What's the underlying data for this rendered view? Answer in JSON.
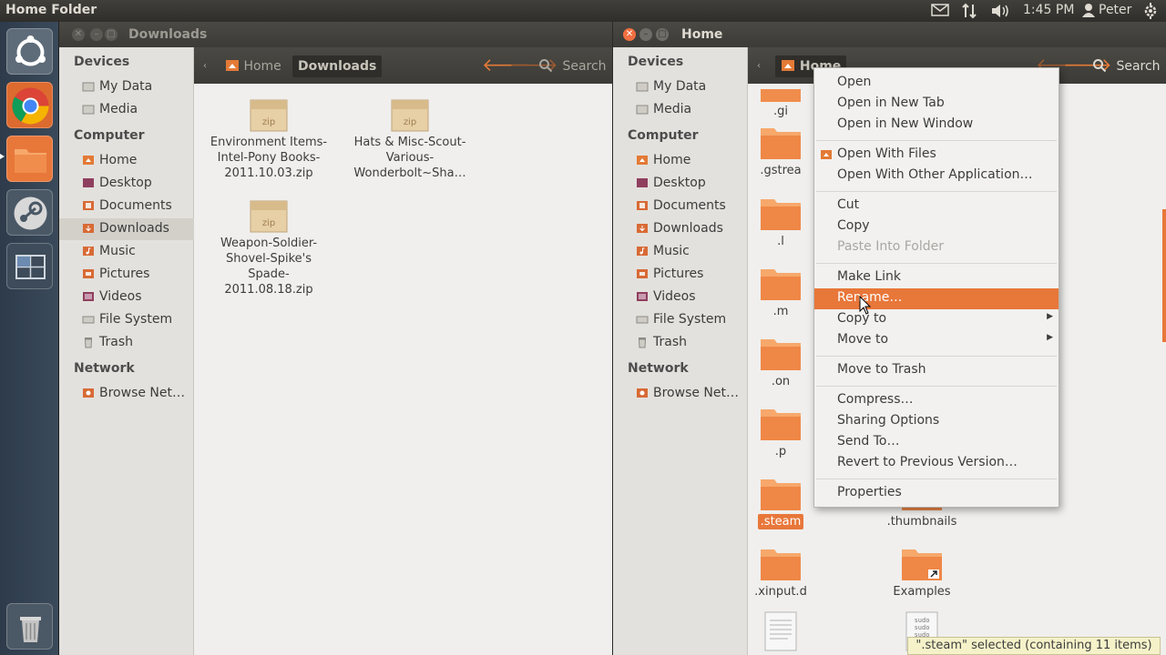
{
  "topbar": {
    "title": "Home Folder",
    "time": "1:45 PM",
    "user": "Peter",
    "icons": [
      "mail-icon",
      "network-icon",
      "volume-icon",
      "user-icon",
      "gear-icon"
    ]
  },
  "launcher": {
    "items": [
      "ubuntu-dash-icon",
      "chrome-icon",
      "files-icon",
      "steam-icon",
      "workspace-switcher-icon",
      "trash-icon"
    ]
  },
  "win_downloads": {
    "title": "Downloads",
    "sidebar": {
      "devices_head": "Devices",
      "devices": [
        "My Data",
        "Media"
      ],
      "computer_head": "Computer",
      "computer": [
        "Home",
        "Desktop",
        "Documents",
        "Downloads",
        "Music",
        "Pictures",
        "Videos",
        "File System",
        "Trash"
      ],
      "network_head": "Network",
      "network": [
        "Browse Net…"
      ]
    },
    "crumbs": [
      "Home",
      "Downloads"
    ],
    "search_label": "Search",
    "files": [
      {
        "icon": "zip",
        "name": "Environment Items-Intel-Pony Books-2011.10.03.zip"
      },
      {
        "icon": "zip",
        "name": "Hats & Misc-Scout-Various-Wonderbolt~Sha…"
      },
      {
        "icon": "zip",
        "name": "Weapon-Soldier-Shovel-Spike's Spade-2011.08.18.zip"
      }
    ]
  },
  "win_home": {
    "title": "Home",
    "sidebar": {
      "devices_head": "Devices",
      "devices": [
        "My Data",
        "Media"
      ],
      "computer_head": "Computer",
      "computer": [
        "Home",
        "Desktop",
        "Documents",
        "Downloads",
        "Music",
        "Pictures",
        "Videos",
        "File System",
        "Trash"
      ],
      "network_head": "Network",
      "network": [
        "Browse Net…"
      ]
    },
    "crumb": "Home",
    "search_label": "Search",
    "files_visible": [
      ".gi",
      ".gstrea",
      ".l",
      ".m",
      ".on",
      ".p",
      ".steam",
      ".thumbnails",
      ".xinput.d",
      "Examples"
    ]
  },
  "context_menu": {
    "groups": [
      [
        "Open",
        "Open in New Tab",
        "Open in New Window"
      ],
      [
        "Open With Files",
        "Open With Other Application…"
      ],
      [
        "Cut",
        "Copy",
        "Paste Into Folder"
      ],
      [
        "Make Link",
        "Rename…",
        "Copy to",
        "Move to"
      ],
      [
        "Move to Trash"
      ],
      [
        "Compress…",
        "Sharing Options",
        "Send To…",
        "Revert to Previous Version…"
      ],
      [
        "Properties"
      ]
    ],
    "highlighted": "Rename…",
    "disabled": [
      "Paste Into Folder"
    ],
    "submenus": [
      "Copy to",
      "Move to"
    ]
  },
  "status": "\".steam\" selected (containing 11 items)",
  "colors": {
    "accent": "#e8773a",
    "panel": "#3c3b37",
    "sidebar": "#e3e1dd",
    "content": "#f0efed"
  }
}
